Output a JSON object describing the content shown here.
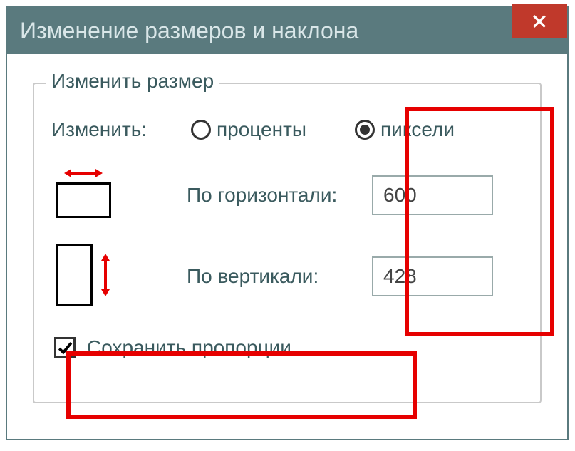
{
  "window": {
    "title": "Изменение размеров и наклона"
  },
  "group": {
    "legend": "Изменить размер",
    "unit_label": "Изменить:",
    "radio_percent": "проценты",
    "radio_pixels": "пиксели",
    "horizontal_label": "По горизонтали:",
    "vertical_label": "По вертикали:",
    "horizontal_value": "600",
    "vertical_value": "428",
    "keep_aspect": "Сохранить пропорции"
  },
  "state": {
    "unit_selected": "pixels",
    "keep_aspect_checked": true
  },
  "colors": {
    "titlebar": "#5a7a7e",
    "close": "#c0392b",
    "highlight": "#e60000"
  }
}
